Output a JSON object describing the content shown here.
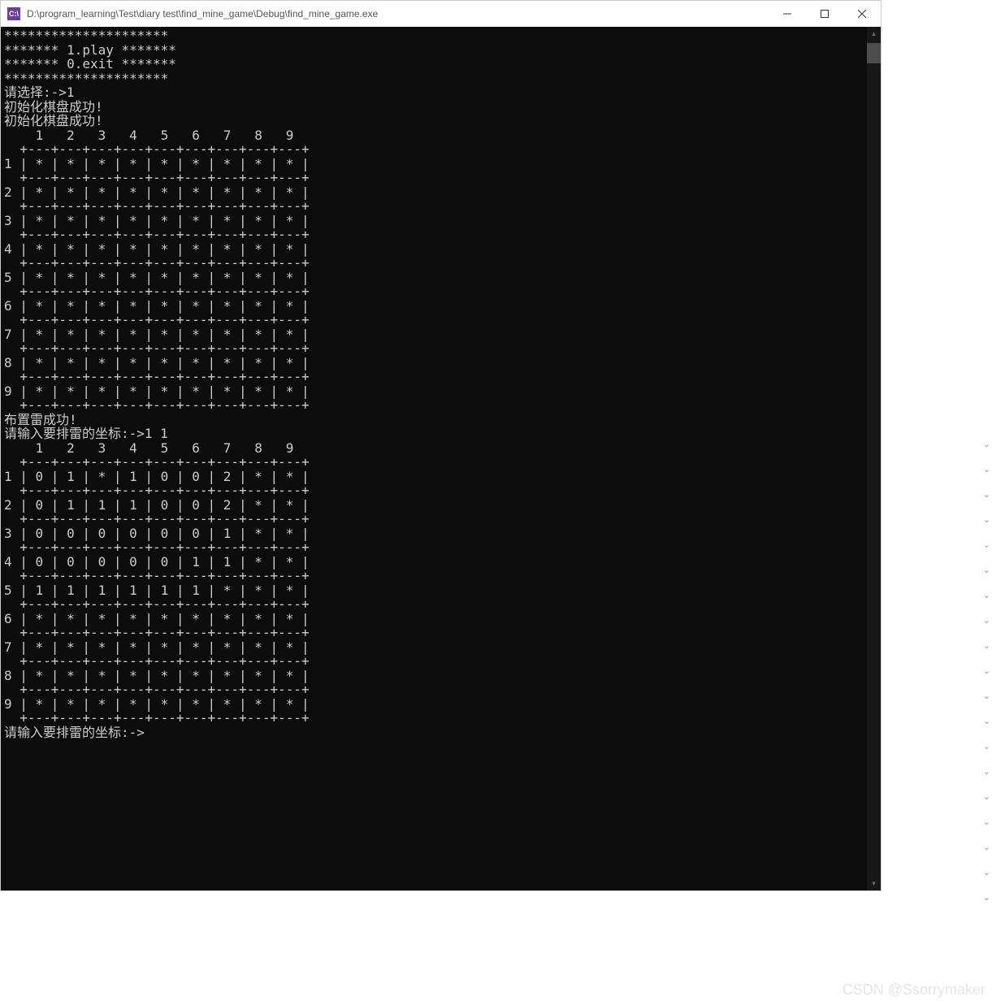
{
  "window": {
    "icon_text": "C:\\",
    "title": "D:\\program_learning\\Test\\diary test\\find_mine_game\\Debug\\find_mine_game.exe"
  },
  "menu": {
    "border": "*********************",
    "option1": "******* 1.play *******",
    "option2": "******* 0.exit *******"
  },
  "prompts": {
    "choose": "请选择:->",
    "choose_input": "1",
    "init_ok": "初始化棋盘成功!",
    "mine_ok": "布置雷成功!",
    "coord_prompt": "请输入要排雷的坐标:->",
    "coord_input": "1 1"
  },
  "board": {
    "cols": [
      "1",
      "2",
      "3",
      "4",
      "5",
      "6",
      "7",
      "8",
      "9"
    ],
    "rows": [
      "1",
      "2",
      "3",
      "4",
      "5",
      "6",
      "7",
      "8",
      "9"
    ],
    "initial": [
      [
        "*",
        "*",
        "*",
        "*",
        "*",
        "*",
        "*",
        "*",
        "*"
      ],
      [
        "*",
        "*",
        "*",
        "*",
        "*",
        "*",
        "*",
        "*",
        "*"
      ],
      [
        "*",
        "*",
        "*",
        "*",
        "*",
        "*",
        "*",
        "*",
        "*"
      ],
      [
        "*",
        "*",
        "*",
        "*",
        "*",
        "*",
        "*",
        "*",
        "*"
      ],
      [
        "*",
        "*",
        "*",
        "*",
        "*",
        "*",
        "*",
        "*",
        "*"
      ],
      [
        "*",
        "*",
        "*",
        "*",
        "*",
        "*",
        "*",
        "*",
        "*"
      ],
      [
        "*",
        "*",
        "*",
        "*",
        "*",
        "*",
        "*",
        "*",
        "*"
      ],
      [
        "*",
        "*",
        "*",
        "*",
        "*",
        "*",
        "*",
        "*",
        "*"
      ],
      [
        "*",
        "*",
        "*",
        "*",
        "*",
        "*",
        "*",
        "*",
        "*"
      ]
    ],
    "after_move": [
      [
        "0",
        "1",
        "*",
        "1",
        "0",
        "0",
        "2",
        "*",
        "*"
      ],
      [
        "0",
        "1",
        "1",
        "1",
        "0",
        "0",
        "2",
        "*",
        "*"
      ],
      [
        "0",
        "0",
        "0",
        "0",
        "0",
        "0",
        "1",
        "*",
        "*"
      ],
      [
        "0",
        "0",
        "0",
        "0",
        "0",
        "1",
        "1",
        "*",
        "*"
      ],
      [
        "1",
        "1",
        "1",
        "1",
        "1",
        "1",
        "*",
        "*",
        "*"
      ],
      [
        "*",
        "*",
        "*",
        "*",
        "*",
        "*",
        "*",
        "*",
        "*"
      ],
      [
        "*",
        "*",
        "*",
        "*",
        "*",
        "*",
        "*",
        "*",
        "*"
      ],
      [
        "*",
        "*",
        "*",
        "*",
        "*",
        "*",
        "*",
        "*",
        "*"
      ],
      [
        "*",
        "*",
        "*",
        "*",
        "*",
        "*",
        "*",
        "*",
        "*"
      ]
    ]
  },
  "watermark": "CSDN @Ssorrymaker"
}
